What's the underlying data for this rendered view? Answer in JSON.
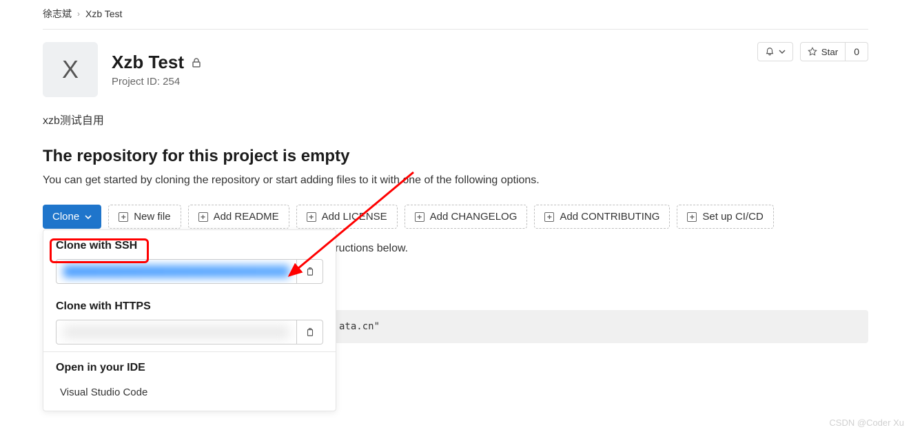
{
  "breadcrumb": {
    "owner": "徐志斌",
    "project": "Xzb Test"
  },
  "project": {
    "avatar_letter": "X",
    "title": "Xzb Test",
    "id_label": "Project ID: 254",
    "description": "xzb测试自用"
  },
  "header_actions": {
    "star_label": "Star",
    "star_count": "0"
  },
  "empty_state": {
    "title": "The repository for this project is empty",
    "subtitle": "You can get started by cloning the repository or start adding files to it with one of the following options."
  },
  "actions": {
    "clone": "Clone",
    "new_file": "New file",
    "add_readme": "Add README",
    "add_license": "Add LICENSE",
    "add_changelog": "Add CHANGELOG",
    "add_contributing": "Add CONTRIBUTING",
    "setup_cicd": "Set up CI/CD"
  },
  "instruction_tail": "using the instructions below.",
  "code_tail": "ata.cn\"",
  "dropdown": {
    "ssh_label": "Clone with SSH",
    "https_label": "Clone with HTTPS",
    "ide_label": "Open in your IDE",
    "ide_items": [
      "Visual Studio Code"
    ]
  },
  "watermark": "CSDN @Coder Xu"
}
